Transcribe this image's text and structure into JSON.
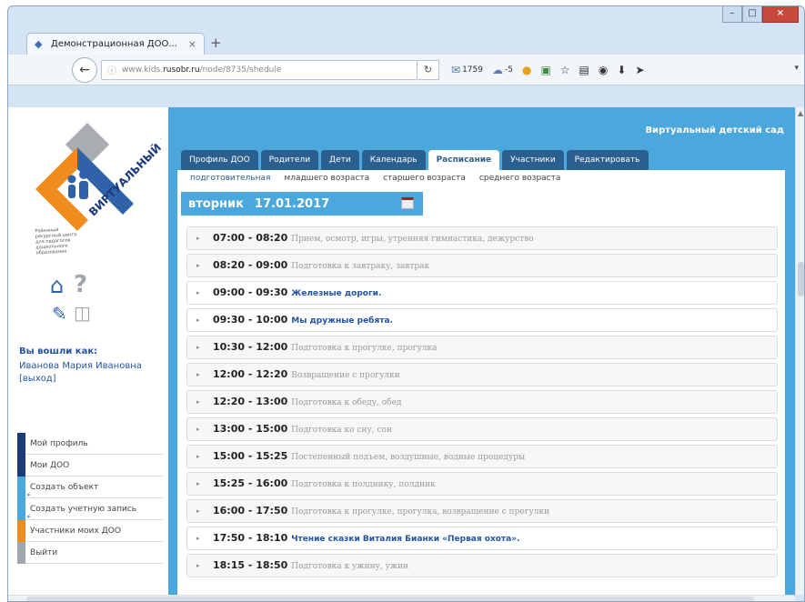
{
  "browser": {
    "tab_title": "Демонстрационная ДОО...",
    "tab_close": "×",
    "new_tab": "+",
    "url_prefix": "www.kids.",
    "url_host": "rusobr.ru",
    "url_path": "/node/8735/shedule",
    "mail_count": "1759",
    "weather": "-5"
  },
  "site": {
    "title": "Виртуальный детский сад"
  },
  "tabs": [
    {
      "label": "Профиль ДОО"
    },
    {
      "label": "Родители"
    },
    {
      "label": "Дети"
    },
    {
      "label": "Календарь"
    },
    {
      "label": "Расписание"
    },
    {
      "label": "Участники"
    },
    {
      "label": "Редактировать"
    }
  ],
  "subtabs": [
    {
      "label": "подготовительная"
    },
    {
      "label": "младшего возраста"
    },
    {
      "label": "старшего возраста"
    },
    {
      "label": "среднего возраста"
    }
  ],
  "day": {
    "weekday": "вторник",
    "date": "17.01.2017"
  },
  "user": {
    "label": "Вы вошли как:",
    "name": "Иванова Мария Ивановна",
    "logout": "[выход]"
  },
  "logo": {
    "text": "ВИРТУАЛЬНЫЙ ДЕТСКИЙ САД",
    "caption": "Районный ресурсный центр для педагогов дошкольного образования"
  },
  "menu": [
    {
      "label": "Мой профиль",
      "color": "#1a3a7a"
    },
    {
      "label": "Мои ДОО",
      "color": "#1a3a7a"
    },
    {
      "label": "Создать объект",
      "color": "#4aa8dc"
    },
    {
      "label": "Создать учетную запись",
      "color": "#4aa8dc"
    },
    {
      "label": "Участники моих ДОО",
      "color": "#f08c1e"
    },
    {
      "label": "Выйти",
      "color": "#a0a6ad"
    }
  ],
  "schedule": [
    {
      "time": "07:00 - 08:20",
      "desc": "Прием, осмотр, игры, утренняя гимнастика, дежурство",
      "link": false
    },
    {
      "time": "08:20 - 09:00",
      "desc": "Подготовка к завтраку, завтрак",
      "link": false
    },
    {
      "time": "09:00 - 09:30",
      "desc": "Железные дороги.",
      "link": true
    },
    {
      "time": "09:30 - 10:00",
      "desc": "Мы дружные ребята.",
      "link": true
    },
    {
      "time": "10:30 - 12:00",
      "desc": "Подготовка к прогулке, прогулка",
      "link": false
    },
    {
      "time": "12:00 - 12:20",
      "desc": "Возвращение с прогулки",
      "link": false
    },
    {
      "time": "12:20 - 13:00",
      "desc": "Подготовка к обеду, обед",
      "link": false
    },
    {
      "time": "13:00 - 15:00",
      "desc": "Подготовка ко сну, сон",
      "link": false
    },
    {
      "time": "15:00 - 15:25",
      "desc": "Постепенный подъем, воздушные, водные процедуры",
      "link": false
    },
    {
      "time": "15:25 - 16:00",
      "desc": "Подготовка к полднику, полдник",
      "link": false
    },
    {
      "time": "16:00 - 17:50",
      "desc": "Подготовка к прогулке, прогулка, возвращение с прогулки",
      "link": false
    },
    {
      "time": "17:50 - 18:10",
      "desc": "Чтение сказки Виталия Бианки «Первая охота».",
      "link": true
    },
    {
      "time": "18:15 - 18:50",
      "desc": "Подготовка к ужину, ужин",
      "link": false
    }
  ],
  "colors": {
    "accent": "#4aa8dc",
    "tab_dark": "#2b5f8f",
    "link": "#2454a4",
    "logo_blue": "#2f62a8",
    "logo_orange": "#f08c1e"
  }
}
